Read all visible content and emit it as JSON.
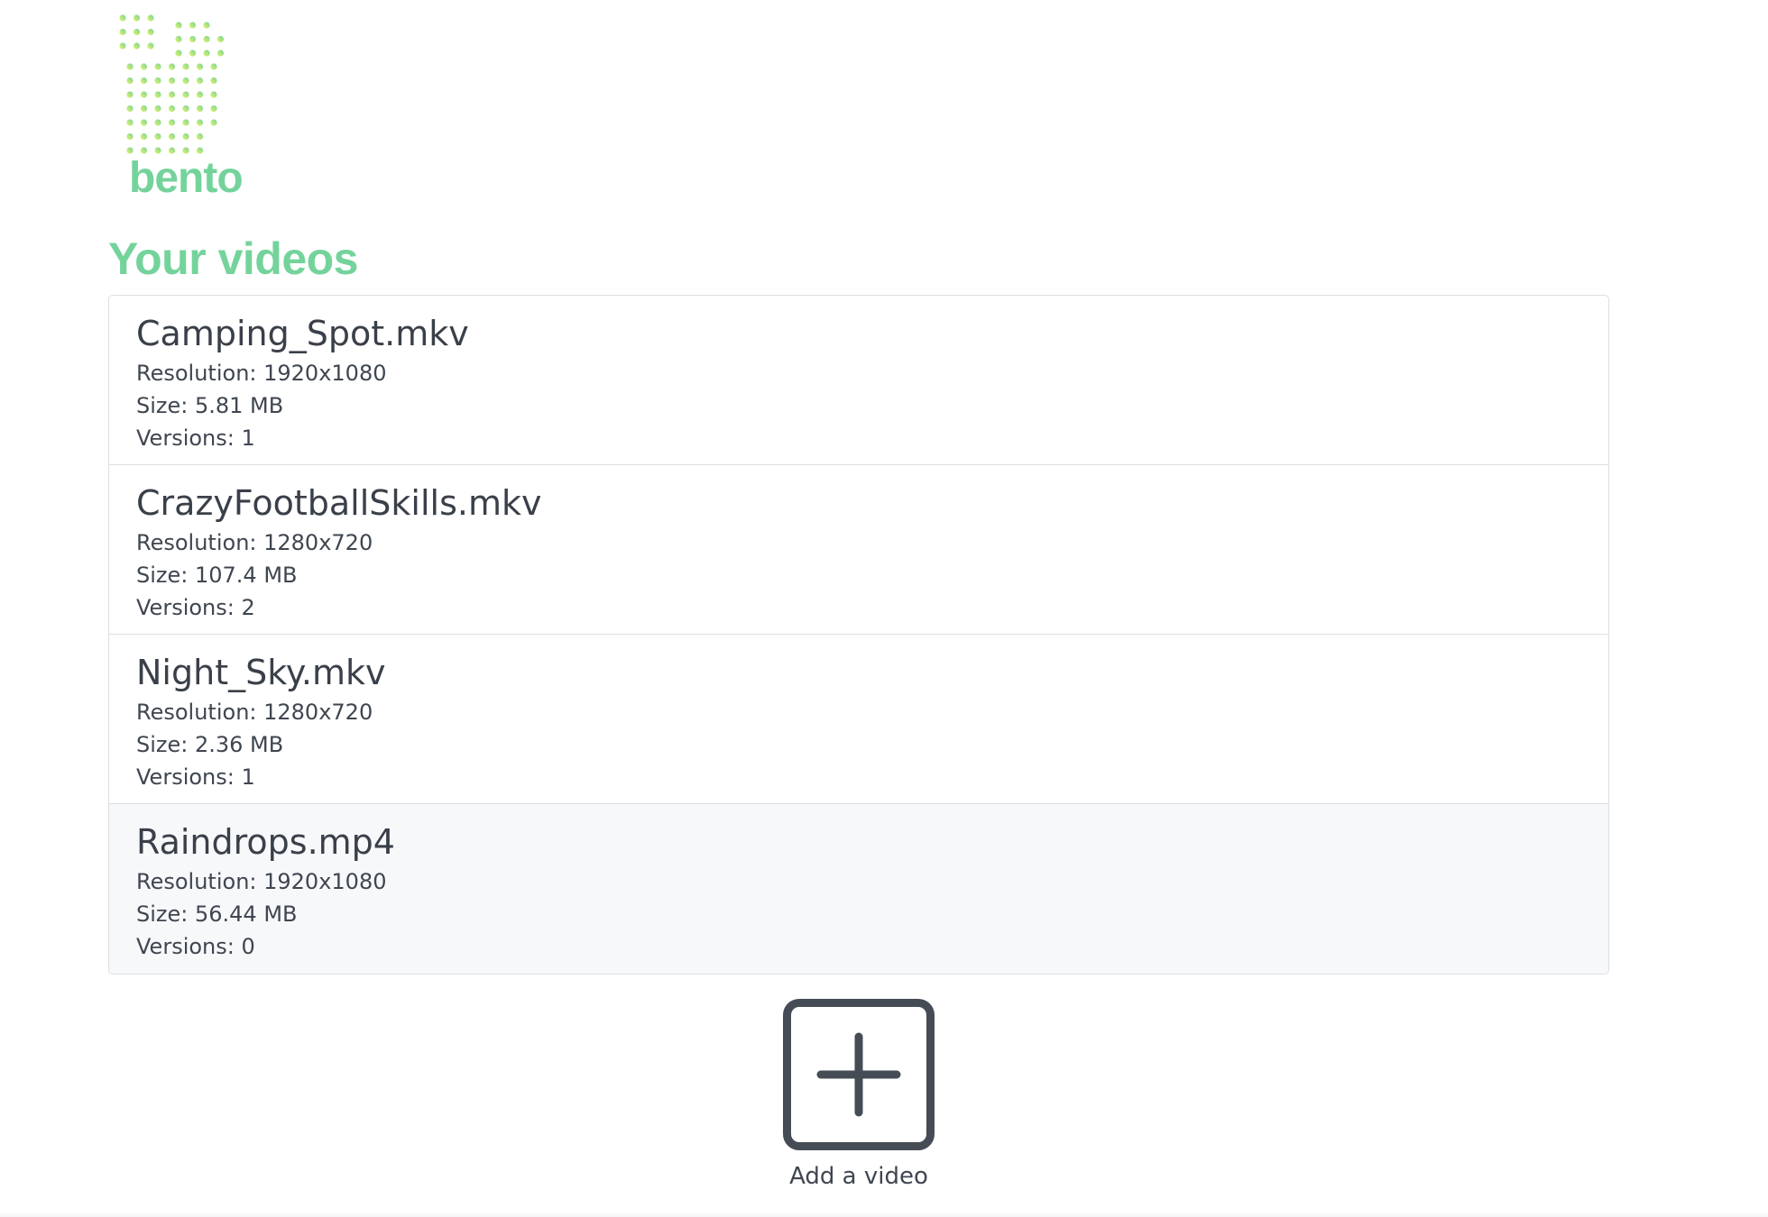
{
  "brand": {
    "name": "bento",
    "accent_color": "#74d39b",
    "logo_gradient": [
      "#74d39b",
      "#e7f56a"
    ]
  },
  "header": {
    "title": "Your videos"
  },
  "videos": [
    {
      "name": "Camping_Spot.mkv",
      "resolution": "Resolution: 1920x1080",
      "size": "Size: 5.81 MB",
      "versions": "Versions: 1"
    },
    {
      "name": "CrazyFootballSkills.mkv",
      "resolution": "Resolution: 1280x720",
      "size": "Size: 107.4 MB",
      "versions": "Versions: 2"
    },
    {
      "name": "Night_Sky.mkv",
      "resolution": "Resolution: 1280x720",
      "size": "Size: 2.36 MB",
      "versions": "Versions: 1"
    },
    {
      "name": "Raindrops.mp4",
      "resolution": "Resolution: 1920x1080",
      "size": "Size: 56.44 MB",
      "versions": "Versions: 0"
    }
  ],
  "add_video": {
    "label": "Add a video",
    "icon": "plus-square-icon"
  }
}
